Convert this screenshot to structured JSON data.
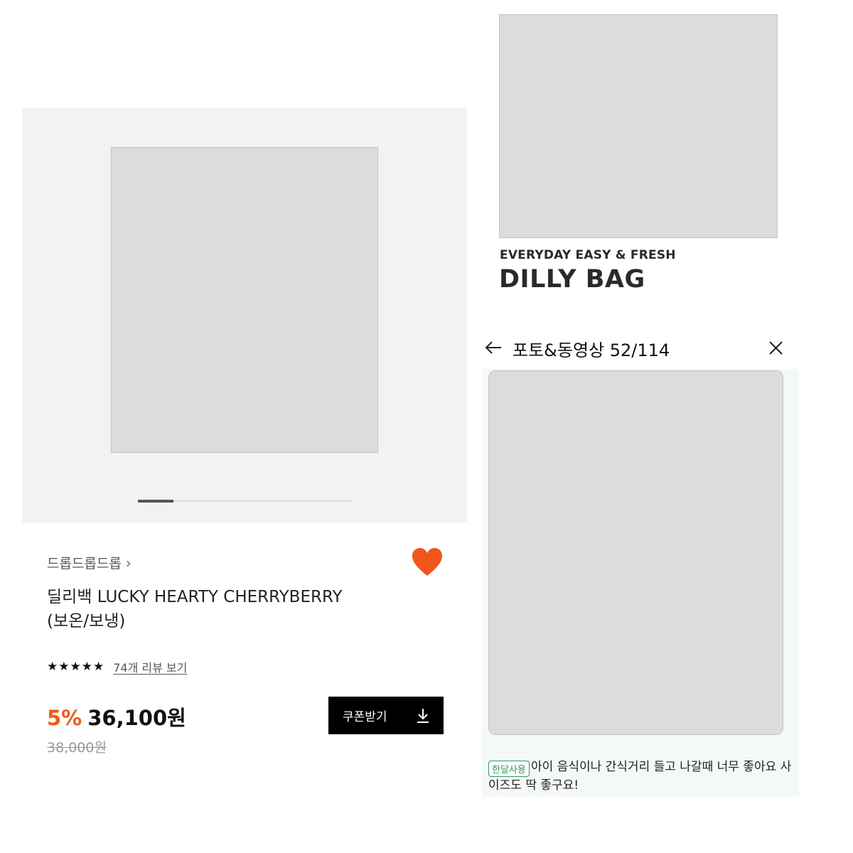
{
  "product": {
    "brand": "드롭드롭드롭",
    "title_line1": "딜리백 LUCKY HEARTY CHERRYBERRY",
    "title_line2": "(보온/보냉)",
    "rating_stars": "★★★★★",
    "review_link": "74개 리뷰 보기",
    "discount": "5%",
    "price": "36,100원",
    "original_price": "38,000원",
    "coupon_label": "쿠폰받기",
    "carousel": {
      "current": 1,
      "total": 6
    },
    "colors": {
      "accent": "#f05a14",
      "heart": "#f2551c"
    }
  },
  "promo": {
    "subtitle": "EVERYDAY EASY & FRESH",
    "title": "DILLY BAG"
  },
  "review_viewer": {
    "title": "포토&동영상 52/114",
    "badge": "한달사용",
    "text": "아이 음식이나 간식거리 들고 나갈때 너무 좋아요 사이즈도 딱 좋구요!"
  }
}
